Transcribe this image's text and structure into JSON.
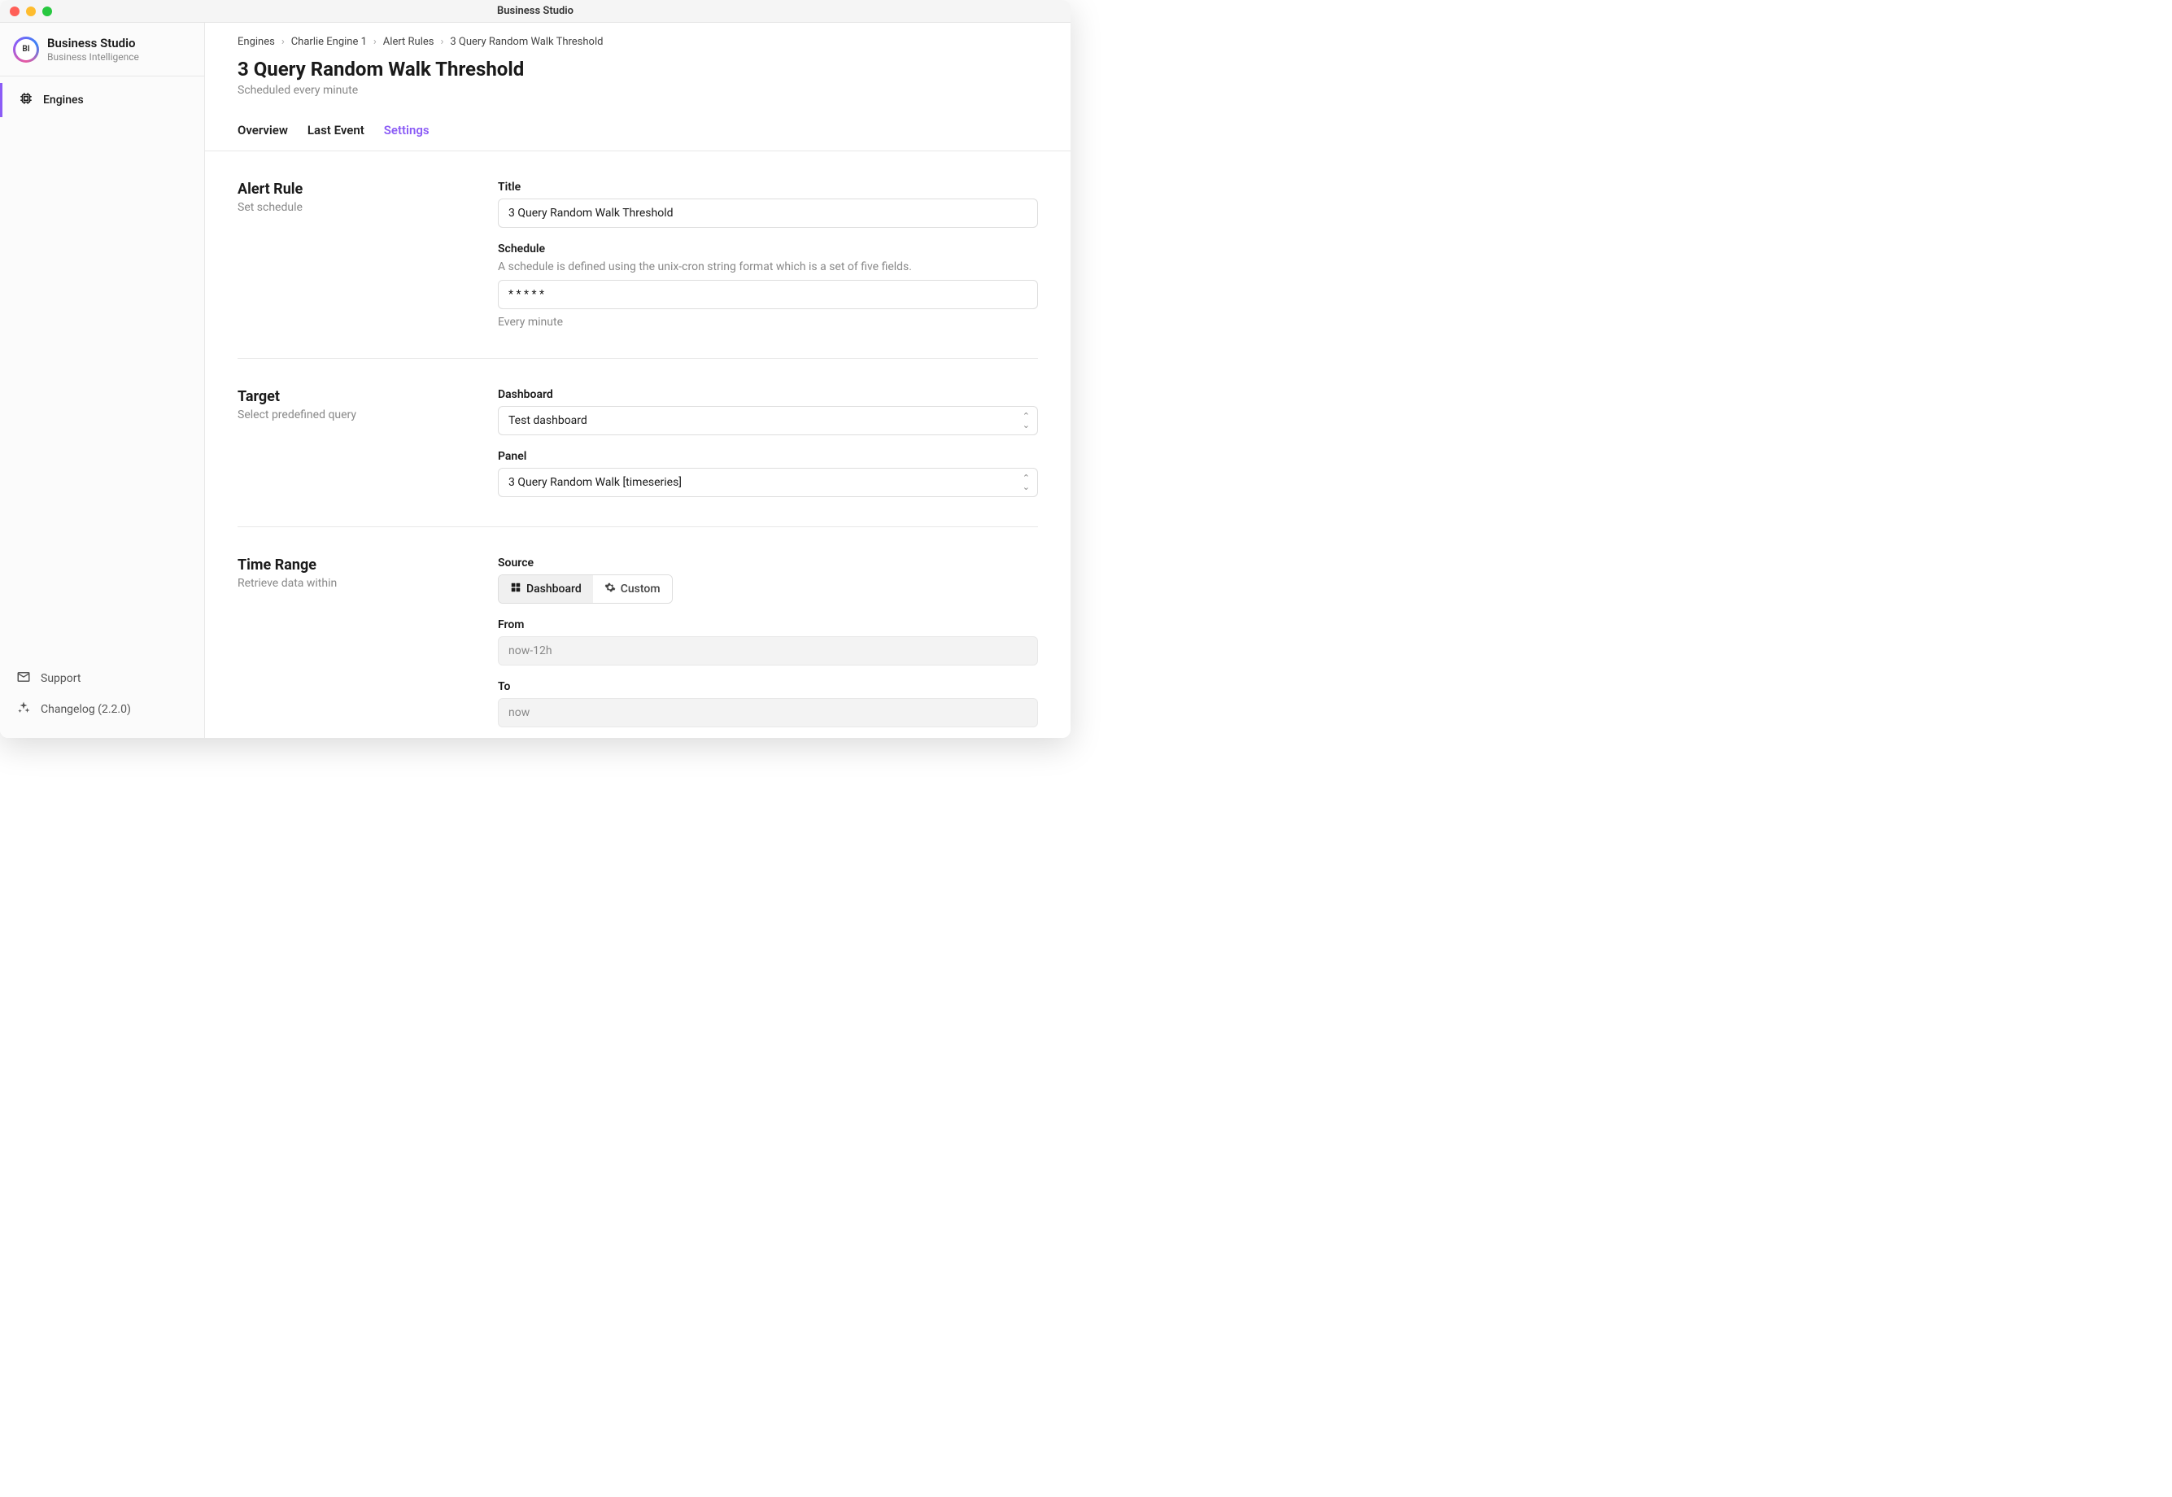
{
  "window": {
    "title": "Business Studio"
  },
  "sidebar": {
    "app_name": "Business Studio",
    "app_tagline": "Business Intelligence",
    "logo_text": "BI",
    "nav": {
      "engines": "Engines"
    },
    "footer": {
      "support": "Support",
      "changelog": "Changelog (2.2.0)"
    }
  },
  "breadcrumbs": {
    "engines": "Engines",
    "engine": "Charlie Engine 1",
    "alert_rules": "Alert Rules",
    "current": "3 Query Random Walk Threshold"
  },
  "page": {
    "title": "3 Query Random Walk Threshold",
    "subtitle": "Scheduled every minute"
  },
  "tabs": {
    "overview": "Overview",
    "last_event": "Last Event",
    "settings": "Settings"
  },
  "alert_rule": {
    "section_title": "Alert Rule",
    "section_desc": "Set schedule",
    "title_label": "Title",
    "title_value": "3 Query Random Walk Threshold",
    "schedule_label": "Schedule",
    "schedule_help": "A schedule is defined using the unix-cron string format which is a set of five fields.",
    "schedule_value": "* * * * *",
    "schedule_hint": "Every minute"
  },
  "target": {
    "section_title": "Target",
    "section_desc": "Select predefined query",
    "dashboard_label": "Dashboard",
    "dashboard_value": "Test dashboard",
    "panel_label": "Panel",
    "panel_value": "3 Query Random Walk [timeseries]"
  },
  "time_range": {
    "section_title": "Time Range",
    "section_desc": "Retrieve data within",
    "source_label": "Source",
    "source_dashboard": "Dashboard",
    "source_custom": "Custom",
    "from_label": "From",
    "from_value": "now-12h",
    "to_label": "To",
    "to_value": "now"
  }
}
